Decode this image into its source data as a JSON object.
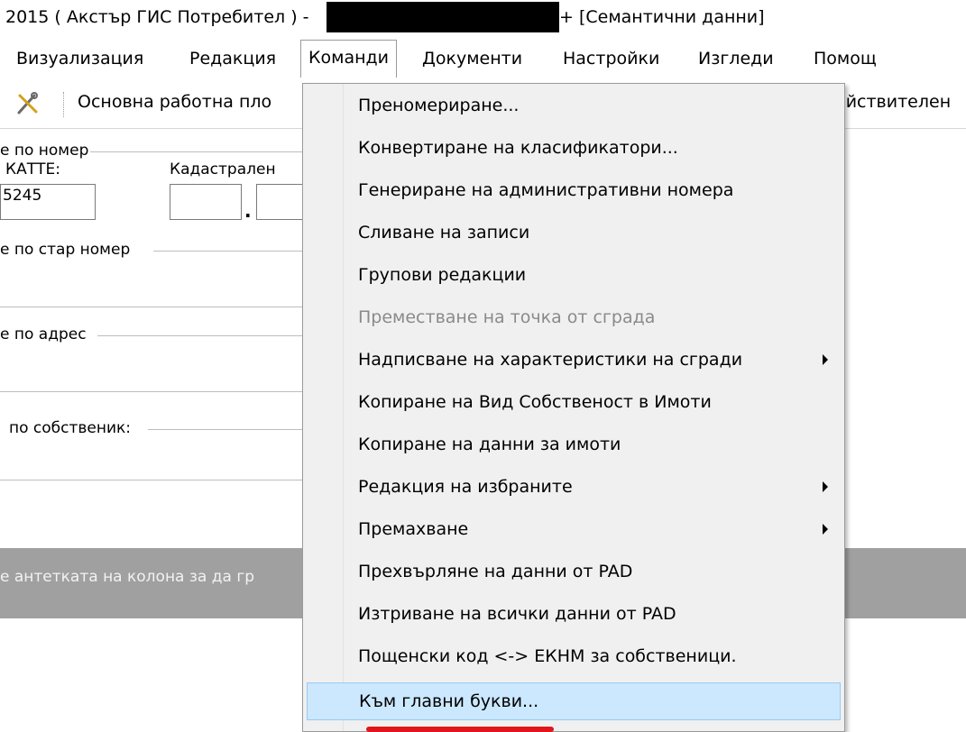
{
  "title": {
    "prefix": "2015 ( Акстър ГИС  Потребител ) -",
    "suffix": "+ [Семантични данни]"
  },
  "menubar": {
    "items": [
      {
        "label": "Визуализация"
      },
      {
        "label": "Редакция"
      },
      {
        "label": "Команди"
      },
      {
        "label": "Документи"
      },
      {
        "label": "Настройки"
      },
      {
        "label": "Изгледи"
      },
      {
        "label": "Помощ"
      }
    ]
  },
  "toolbar": {
    "icon": "tools-icon",
    "workspace_label": "Основна работна пло",
    "right_text": "ействителен"
  },
  "form": {
    "search_by_number": "е по номер",
    "ekatte_label": "КАТТЕ:",
    "ekatte_value": "5245",
    "cadastral_label": "Кадастрален",
    "search_by_old_number": "е по стар номер",
    "search_by_address": "е по адрес",
    "search_by_owner": "по собственик:"
  },
  "grouping": {
    "hint": "е антетката на колона за да гр"
  },
  "dropdown": {
    "items": [
      {
        "label": "Преномериране...",
        "disabled": false,
        "submenu": false
      },
      {
        "label": "Конвертиране на класификатори...",
        "disabled": false,
        "submenu": false
      },
      {
        "label": "Генериране на административни номера",
        "disabled": false,
        "submenu": false
      },
      {
        "label": "Сливане на записи",
        "disabled": false,
        "submenu": false
      },
      {
        "label": "Групови редакции",
        "disabled": false,
        "submenu": false
      },
      {
        "label": "Преместване на точка от сграда",
        "disabled": true,
        "submenu": false
      },
      {
        "label": "Надписване на характеристики на сгради",
        "disabled": false,
        "submenu": true
      },
      {
        "label": "Копиране на Вид Собственост в Имоти",
        "disabled": false,
        "submenu": false
      },
      {
        "label": "Копиране на данни за имоти",
        "disabled": false,
        "submenu": false
      },
      {
        "label": "Редакция на избраните",
        "disabled": false,
        "submenu": true
      },
      {
        "label": "Премахване",
        "disabled": false,
        "submenu": true
      },
      {
        "label": "Прехвърляне на данни от PAD",
        "disabled": false,
        "submenu": false
      },
      {
        "label": "Изтриване на всички данни от PAD",
        "disabled": false,
        "submenu": false
      },
      {
        "label": "Пощенски код <-> ЕКНМ за собственици.",
        "disabled": false,
        "submenu": false
      },
      {
        "label": "Към главни букви...",
        "disabled": false,
        "submenu": false,
        "highlighted": true
      }
    ]
  },
  "colors": {
    "accent_red": "#e3141b",
    "highlight_bg": "#cce8ff",
    "menu_bg": "#f0f0f0",
    "group_panel": "#a0a0a0"
  }
}
